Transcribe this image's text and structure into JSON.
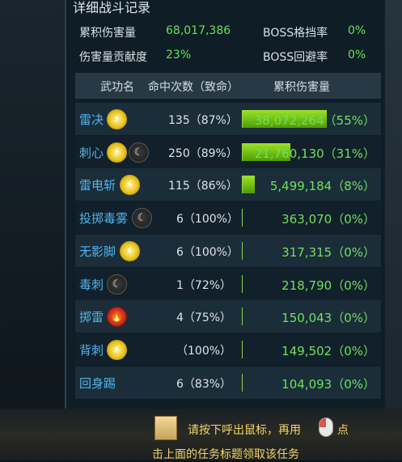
{
  "title": "详细战斗记录",
  "stats": {
    "total_damage_label": "累积伤害量",
    "total_damage_value": "68,017,386",
    "contribution_label": "伤害量贡献度",
    "contribution_value": "23%",
    "boss_block_label": "BOSS格挡率",
    "boss_block_value": "0%",
    "boss_dodge_label": "BOSS回避率",
    "boss_dodge_value": "0%"
  },
  "table": {
    "headers": {
      "skill": "武功名",
      "hits": "命中次数（致命）",
      "damage": "累积伤害量"
    },
    "rows": [
      {
        "name": "雷决",
        "icons": [
          "lightning-icon"
        ],
        "hits": "135（87%）",
        "damage": "38,072,264（55%）",
        "share": 55
      },
      {
        "name": "刺心",
        "icons": [
          "lightning-icon",
          "moon-icon"
        ],
        "hits": "250（89%）",
        "damage": "21,760,130（31%）",
        "share": 31
      },
      {
        "name": "雷电斩",
        "icons": [
          "lightning-icon"
        ],
        "hits": "115（86%）",
        "damage": "5,499,184（8%）",
        "share": 8
      },
      {
        "name": "投掷毒雾",
        "icons": [
          "moon-icon"
        ],
        "hits": "6（100%）",
        "damage": "363,070（0%）",
        "share": 0
      },
      {
        "name": "无影脚",
        "icons": [
          "lightning-icon"
        ],
        "hits": "6（100%）",
        "damage": "317,315（0%）",
        "share": 0
      },
      {
        "name": "毒刺",
        "icons": [
          "moon-icon"
        ],
        "hits": "1（72%）",
        "damage": "218,790（0%）",
        "share": 0
      },
      {
        "name": "掷雷",
        "icons": [
          "fire-icon"
        ],
        "hits": "4（75%）",
        "damage": "150,043（0%）",
        "share": 0
      },
      {
        "name": "背刺",
        "icons": [
          "lightning-icon"
        ],
        "hits": "（100%）",
        "damage": "149,502（0%）",
        "share": 0
      },
      {
        "name": "回身踢",
        "icons": [],
        "hits": "6（83%）",
        "damage": "104,093（0%）",
        "share": 0
      }
    ]
  },
  "footer": {
    "line1a": "请按下呼出鼠标，再用",
    "line1b": "点",
    "line2": "击上面的任务标题领取该任务"
  },
  "colors": {
    "skill_name": "#52b4ec",
    "value_green": "#66e05a",
    "bar_green": "#7fd01a",
    "footer_yellow": "#f2d66a"
  }
}
